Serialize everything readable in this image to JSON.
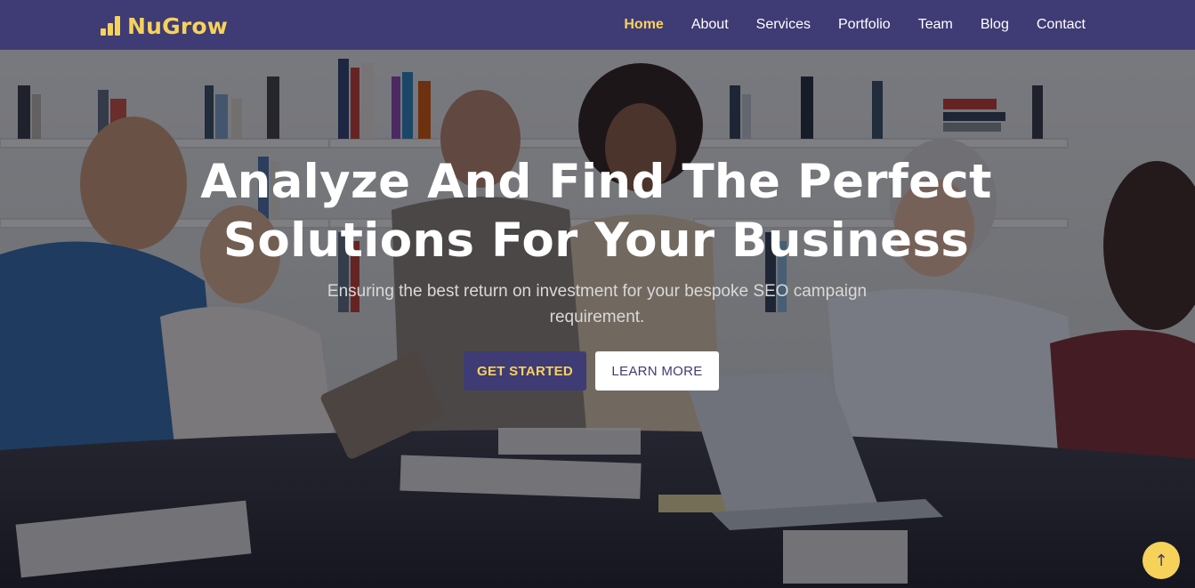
{
  "brand": {
    "name": "NuGrow",
    "logo_icon": "bar-chart-logo-icon",
    "accent_color": "#f6d25b",
    "primary_color": "#3f3b74"
  },
  "nav": {
    "items": [
      {
        "label": "Home",
        "active": true
      },
      {
        "label": "About"
      },
      {
        "label": "Services"
      },
      {
        "label": "Portfolio"
      },
      {
        "label": "Team"
      },
      {
        "label": "Blog"
      },
      {
        "label": "Contact"
      }
    ]
  },
  "hero": {
    "background": "team-meeting-photo",
    "title_line1": "Analyze And Find The Perfect",
    "title_line2": "Solutions For Your Business",
    "subtitle_line1": "Ensuring the best return on investment for your bespoke SEO campaign",
    "subtitle_line2": "requirement.",
    "primary_button": "GET STARTED",
    "secondary_button": "LEARN MORE"
  },
  "scroll_top": {
    "icon": "arrow-up-icon",
    "glyph": "↑"
  }
}
